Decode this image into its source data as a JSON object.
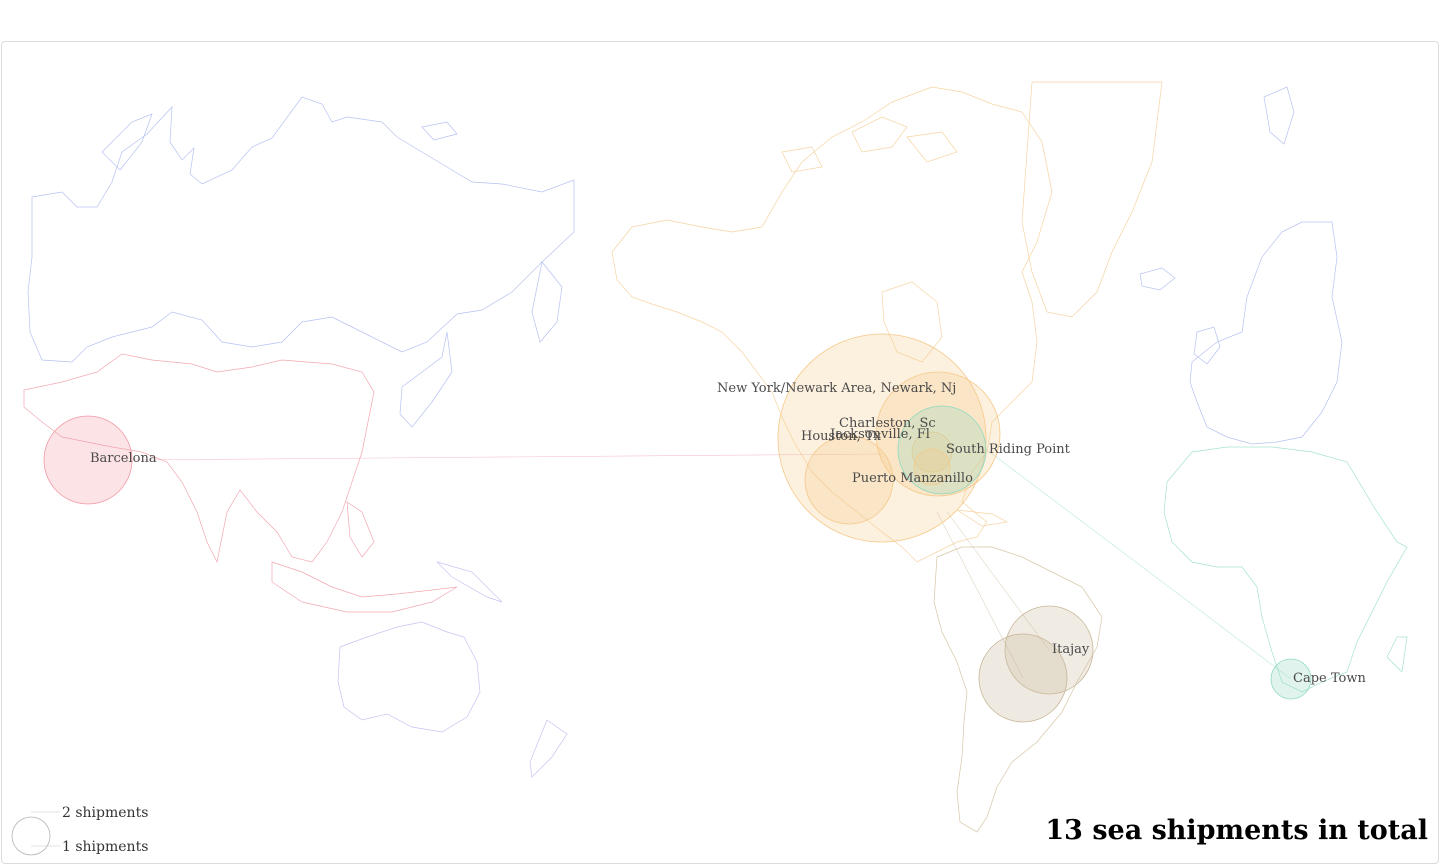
{
  "title": "13 sea shipments in total",
  "legend": {
    "items": [
      {
        "label": "2 shipments",
        "shipments": 2
      },
      {
        "label": "1 shipments",
        "shipments": 1
      }
    ]
  },
  "region_colors": {
    "north_america": "#f6c98a",
    "south_america": "#c9b89a",
    "europe": "#a9b7f0",
    "africa": "#8fd9bf",
    "asia": "#f09aa6",
    "oceania": "#b8b6f0"
  },
  "ports": [
    {
      "name": "Barcelona",
      "region": "asia"
    },
    {
      "name": "New York/Newark Area, Newark, Nj",
      "region": "north_america"
    },
    {
      "name": "Charleston, Sc",
      "region": "north_america"
    },
    {
      "name": "Jacksonville, Fl",
      "region": "north_america"
    },
    {
      "name": "Houston, Tx",
      "region": "north_america"
    },
    {
      "name": "South Riding Point",
      "region": "africa"
    },
    {
      "name": "Puerto Manzanillo",
      "region": "north_america"
    },
    {
      "name": "Itajay",
      "region": "south_america"
    },
    {
      "name": "Cape Town",
      "region": "africa"
    }
  ]
}
